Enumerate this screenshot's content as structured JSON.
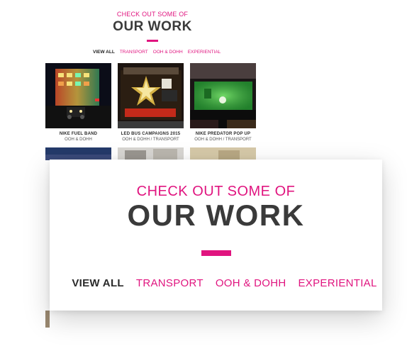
{
  "preview": {
    "kicker": "CHECK OUT SOME OF",
    "title": "OUR WORK",
    "filters": [
      {
        "label": "VIEW ALL"
      },
      {
        "label": "TRANSPORT"
      },
      {
        "label": "OOH & DOHH"
      },
      {
        "label": "EXPERIENTIAL"
      }
    ],
    "projects": [
      {
        "title": "NIKE FUEL BAND",
        "category": "OOH & DOHH"
      },
      {
        "title": "LED BUS CAMPAIGNS 2015",
        "category": "OOH & DOHH / TRANSPORT"
      },
      {
        "title": "NIKE PREDATOR POP UP",
        "category": "OOH & DOHH / TRANSPORT"
      }
    ]
  },
  "zoom": {
    "kicker": "CHECK OUT SOME OF",
    "title": "OUR WORK",
    "filters": [
      {
        "label": "VIEW ALL"
      },
      {
        "label": "TRANSPORT"
      },
      {
        "label": "OOH & DOHH"
      },
      {
        "label": "EXPERIENTIAL"
      }
    ]
  },
  "colors": {
    "accent": "#e0147f",
    "heading": "#3a3a3a",
    "text_dark": "#2a2a2a"
  }
}
